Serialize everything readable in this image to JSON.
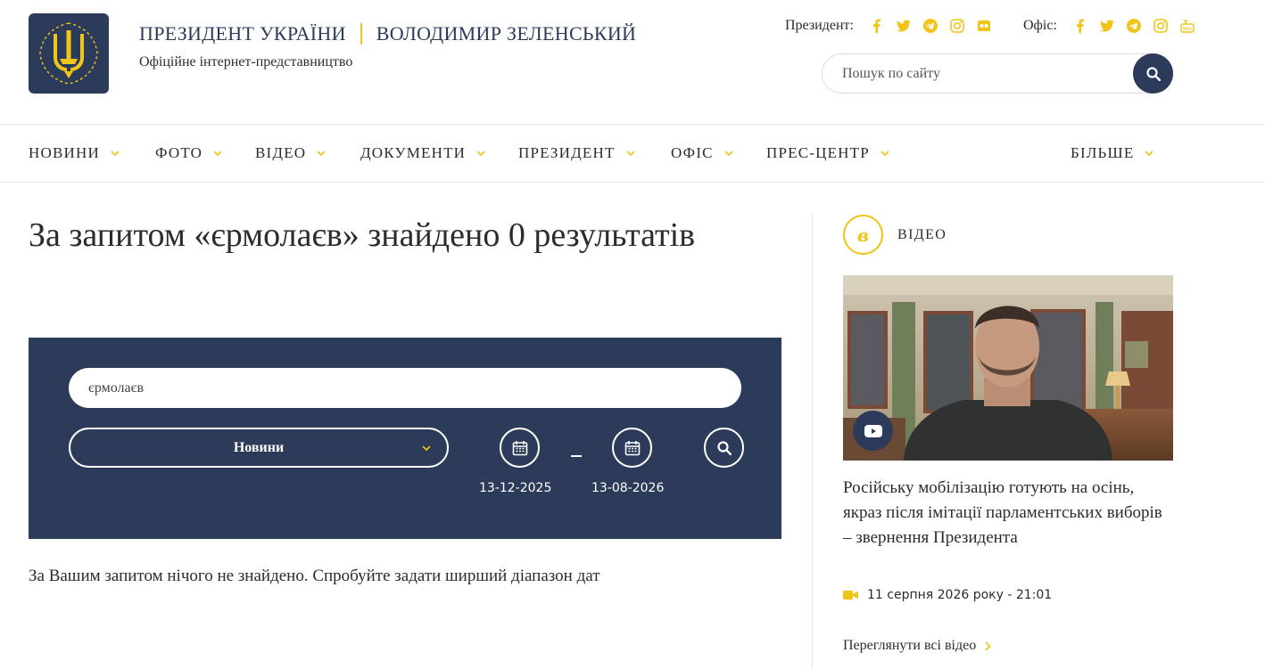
{
  "header": {
    "brand_title": "ПРЕЗИДЕНТ УКРАЇНИ",
    "brand_name": "ВОЛОДИМИР ЗЕЛЕНСЬКИЙ",
    "brand_subtitle": "Офіційне інтернет-представництво",
    "socials_president_label": "Президент:",
    "socials_office_label": "Офіс:",
    "president_icons": [
      "facebook-icon",
      "twitter-icon",
      "telegram-icon",
      "instagram-icon",
      "flickr-icon"
    ],
    "office_icons": [
      "facebook-icon",
      "twitter-icon",
      "telegram-icon",
      "instagram-icon",
      "youtube-icon"
    ],
    "search_placeholder": "Пошук по сайту"
  },
  "nav": {
    "items": [
      "НОВИНИ",
      "ФОТО",
      "ВІДЕО",
      "ДОКУМЕНТИ",
      "ПРЕЗИДЕНТ",
      "ОФІС",
      "ПРЕС-ЦЕНТР"
    ],
    "more": "БІЛЬШЕ"
  },
  "main": {
    "title": "За запитом «єрмолаєв» знайдено 0 результатів",
    "query_value": "єрмолаєв",
    "category": "Новини",
    "date_from": "13-12-2025",
    "date_to": "13-08-2026",
    "no_results": "За Вашим запитом нічого не знайдено. Спробуйте задати ширший діапазон дат"
  },
  "sidebar": {
    "section_label": "ВІДЕО",
    "video_title": "Російську мобілізацію готують на осінь, якраз після імітації парламентських виборів – звернення Президента",
    "video_date": "11 серпня 2026 року - 21:01",
    "all_videos": "Переглянути всі відео"
  },
  "colors": {
    "navy": "#2d3b5b",
    "gold": "#f0c419",
    "text": "#2c2c2c"
  }
}
